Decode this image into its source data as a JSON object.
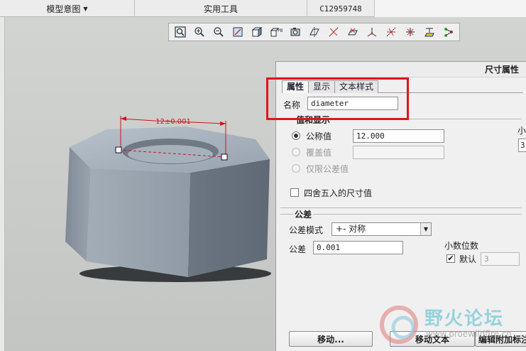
{
  "topbar": {
    "model_intent": "模型意图",
    "utilities": "实用工具",
    "code": "C12959748"
  },
  "toolbar": {
    "icons": [
      "zoom-fit-icon",
      "zoom-in-icon",
      "zoom-out-icon",
      "repaint-icon",
      "shading-icon",
      "display-style-icon",
      "saved-view-icon",
      "datum-plane-icon",
      "datum-axis-icon",
      "datum-point-icon",
      "csys-icon",
      "annotation-icon",
      "spin-center-icon",
      "plane-display-icon",
      "network-icon"
    ]
  },
  "viewport": {
    "dimension_label": "12±0.001"
  },
  "dialog": {
    "title": "尺寸属性",
    "tabs": [
      "属性",
      "显示",
      "文本样式"
    ],
    "name_label": "名称",
    "name_value": "diameter",
    "value_group_title": "值和显示",
    "nominal_label": "公称值",
    "nominal_value": "12.000",
    "override_label": "覆盖值",
    "tolerance_only_label": "仅限公差值",
    "round_label": "四舍五入的尺寸值",
    "right_small_label": "小",
    "right_small_value": "3",
    "tolerance_group_title": "公差",
    "tol_mode_label": "公差模式",
    "tol_mode_value": "+- 对称",
    "tol_label": "公差",
    "tol_value": "0.001",
    "decimal_label": "小数位数",
    "default_label": "默认",
    "default_value": "3",
    "move_button": "移动...",
    "move_text_button": "移动文本",
    "edit_attach_button": "编辑附加标注"
  },
  "watermark": {
    "text": "野火论坛",
    "url": "www.proewildfire.cn"
  }
}
